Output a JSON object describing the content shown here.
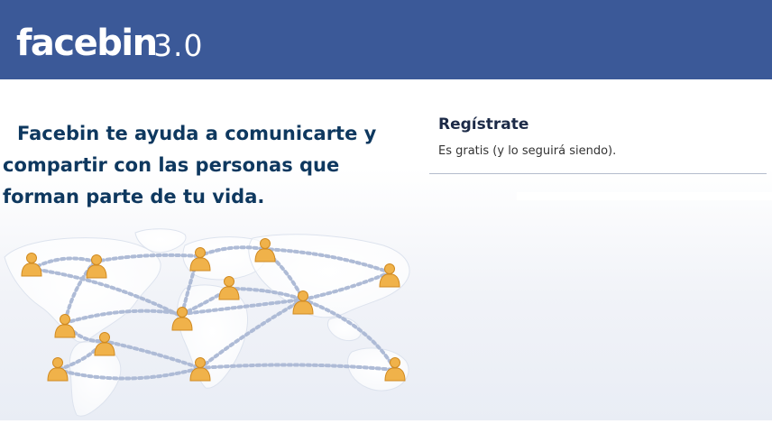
{
  "header": {
    "logo": "facebin",
    "version": "3.0"
  },
  "main": {
    "tagline": "Facebin te ayuda a comunicarte y compartir con las personas que forman parte de tu vida."
  },
  "register": {
    "title": "Regístrate",
    "subtitle": "Es gratis (y lo seguirá siendo)."
  },
  "colors": {
    "brand": "#3b5998",
    "tagline": "#0e385f",
    "person": "#f0b24a"
  }
}
